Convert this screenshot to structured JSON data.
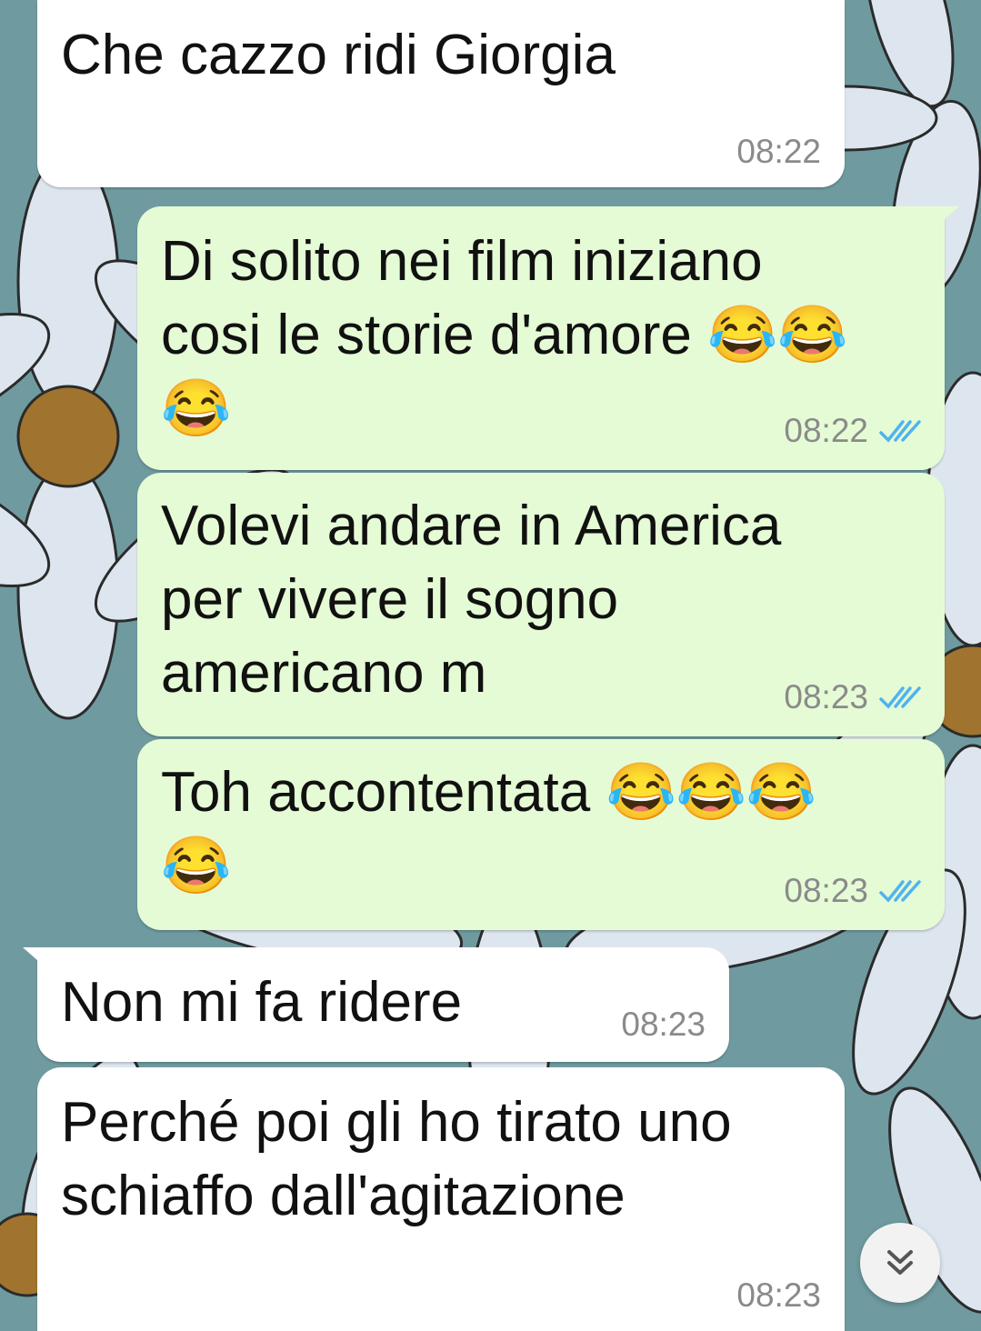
{
  "chat": {
    "messages": [
      {
        "direction": "incoming",
        "text": "Che cazzo ridi Giorgia",
        "time": "08:22"
      },
      {
        "direction": "outgoing",
        "text": "Di solito nei film iniziano\ncosi le storie d'amore 😂😂\n😂",
        "time": "08:22",
        "status": "read"
      },
      {
        "direction": "outgoing",
        "text": "Volevi andare in America\nper vivere il sogno\namericano m",
        "time": "08:23",
        "status": "read"
      },
      {
        "direction": "outgoing",
        "text": "Toh accontentata 😂😂😂\n😂",
        "time": "08:23",
        "status": "read"
      },
      {
        "direction": "incoming",
        "text": "Non mi fa ridere",
        "time": "08:23"
      },
      {
        "direction": "incoming",
        "text": "Perché poi gli ho tirato uno\nschiaffo dall'agitazione",
        "time": "08:23"
      }
    ]
  },
  "scroll_button": {
    "icon": "chevrons-down-icon"
  },
  "colors": {
    "wallpaper": "#6f9ba0",
    "incoming_bubble": "#ffffff",
    "outgoing_bubble": "#e5fbd5",
    "timestamp": "#8a8a8a",
    "read_ticks": "#4fb3f0"
  }
}
